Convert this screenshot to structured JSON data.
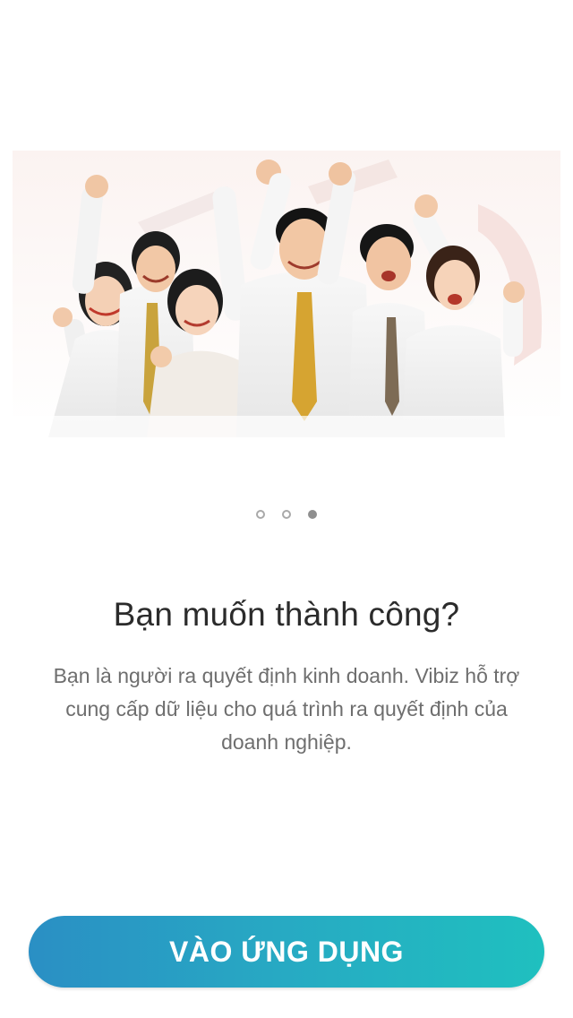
{
  "onboarding": {
    "hero_image": "team-celebrating-illustration",
    "pager": {
      "total": 3,
      "active_index": 2
    },
    "title": "Bạn muốn thành công?",
    "description": "Bạn là người ra quyết định kinh doanh. Vibiz hỗ trợ cung cấp dữ liệu cho quá trình ra quyết định của doanh nghiệp.",
    "cta_label": "VÀO ỨNG DỤNG"
  },
  "colors": {
    "button_gradient_start": "#2a8fc4",
    "button_gradient_end": "#1fc0bf",
    "title_text": "#2b2b2b",
    "body_text": "#6e6e6e",
    "dot_active": "#8f8f8f",
    "dot_inactive_border": "#a9a9a9"
  }
}
